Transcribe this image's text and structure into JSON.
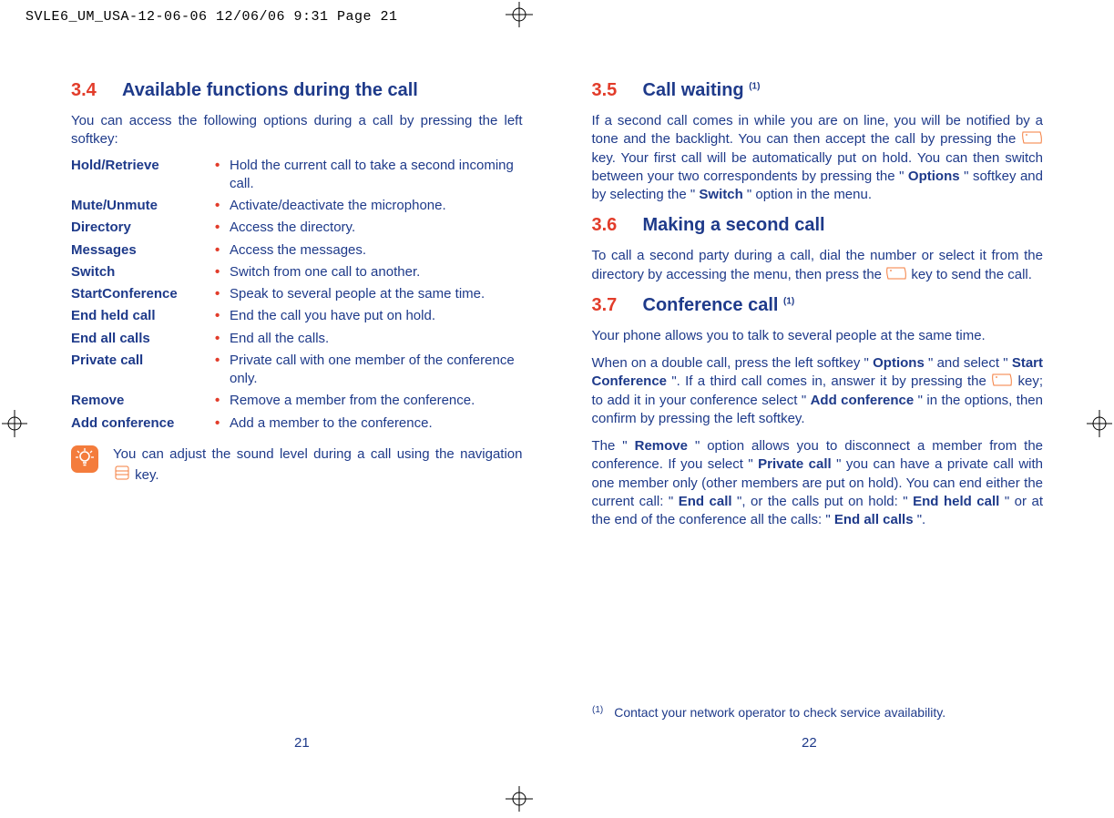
{
  "header": {
    "file_info": "SVLE6_UM_USA-12-06-06  12/06/06  9:31  Page 21"
  },
  "left_page": {
    "section_num": "3.4",
    "section_title": "Available functions during the call",
    "intro": "You can access the following options during a call by pressing the left softkey:",
    "functions": [
      {
        "term": "Hold/Retrieve",
        "desc": "Hold the current call to take a second incoming call."
      },
      {
        "term": "Mute/Unmute",
        "desc": "Activate/deactivate the microphone."
      },
      {
        "term": "Directory",
        "desc": "Access the directory."
      },
      {
        "term": "Messages",
        "desc": "Access the messages."
      },
      {
        "term": "Switch",
        "desc": "Switch from one call to another."
      },
      {
        "term": "StartConference",
        "desc": "Speak to several people at the same time."
      },
      {
        "term": "End held call",
        "desc": "End the call you have put on hold."
      },
      {
        "term": "End all calls",
        "desc": "End all the calls."
      },
      {
        "term": "Private call",
        "desc": "Private call with one member of the conference only."
      },
      {
        "term": "Remove",
        "desc": "Remove a member from the conference."
      },
      {
        "term": "Add conference",
        "desc": "Add a member to the conference."
      }
    ],
    "tip_a": "You can adjust the sound level during a call using the navigation ",
    "tip_b": " key.",
    "page_num": "21"
  },
  "right_page": {
    "sec35_num": "3.5",
    "sec35_title": "Call waiting ",
    "sec35_sup": "(1)",
    "p35_a": "If a second call comes in while you are on line, you will be notified by a tone and the backlight. You can then accept the call by pressing the ",
    "p35_b": " key. Your first call will be automatically put on hold. You can then switch between your two correspondents by pressing the \"",
    "p35_bold1": "Options",
    "p35_c": "\" softkey and by selecting the \"",
    "p35_bold2": "Switch",
    "p35_d": "\" option in the menu.",
    "sec36_num": "3.6",
    "sec36_title": "Making a second call",
    "p36_a": "To call a second party during a call, dial the number or select it from the directory by accessing the menu, then press the ",
    "p36_b": " key to send the call.",
    "sec37_num": "3.7",
    "sec37_title": "Conference call ",
    "sec37_sup": "(1)",
    "p37_1": "Your phone allows you to talk to several people at the same time.",
    "p37_2a": "When on a double call, press the left softkey \"",
    "p37_2b1": "Options",
    "p37_2b": "\" and select \"",
    "p37_2b2": "Start Conference",
    "p37_2c": "\". If a third call comes in, answer it by pressing the ",
    "p37_2d": " key; to add it in your conference select \"",
    "p37_2b3": "Add conference",
    "p37_2e": "\" in the options, then confirm by pressing the left softkey.",
    "p37_3a": "The \"",
    "p37_3b1": "Remove",
    "p37_3b": "\" option allows you to disconnect a member from the conference. If you select \"",
    "p37_3b2": "Private call",
    "p37_3c": "\" you can have a private call with one member only (other members are put on hold). You can end either the current call: \"",
    "p37_3b3": "End call",
    "p37_3d": "\", or the calls put on hold: \"",
    "p37_3b4": "End held call",
    "p37_3e": "\" or at the end of the conference all the calls: \"",
    "p37_3b5": "End all calls",
    "p37_3f": "\".",
    "footnote_mark": "(1)",
    "footnote_text": "Contact your network operator to check service availability.",
    "page_num": "22"
  }
}
